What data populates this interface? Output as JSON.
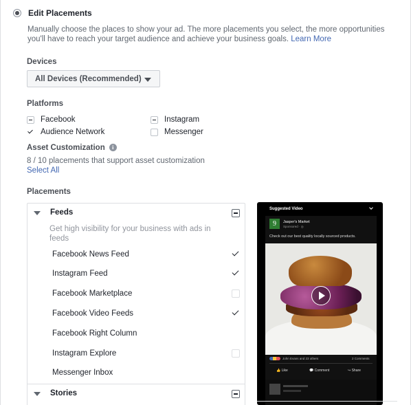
{
  "edit_placements": {
    "title": "Edit Placements",
    "description": "Manually choose the places to show your ad. The more placements you select, the more opportunities you'll have to reach your target audience and achieve your business goals.",
    "learn_more": "Learn More"
  },
  "devices": {
    "label": "Devices",
    "selected": "All Devices (Recommended)"
  },
  "platforms": {
    "label": "Platforms",
    "items": [
      {
        "label": "Facebook",
        "state": "indeterminate"
      },
      {
        "label": "Instagram",
        "state": "indeterminate"
      },
      {
        "label": "Audience Network",
        "state": "checked"
      },
      {
        "label": "Messenger",
        "state": "unchecked"
      }
    ]
  },
  "asset_customization": {
    "label": "Asset Customization",
    "count_text": "8 / 10 placements that support asset customization",
    "select_all": "Select All"
  },
  "placements": {
    "label": "Placements",
    "feeds": {
      "title": "Feeds",
      "description": "Get high visibility for your business with ads in feeds",
      "items": [
        {
          "label": "Facebook News Feed",
          "state": "checked"
        },
        {
          "label": "Instagram Feed",
          "state": "checked"
        },
        {
          "label": "Facebook Marketplace",
          "state": "unchecked"
        },
        {
          "label": "Facebook Video Feeds",
          "state": "checked"
        },
        {
          "label": "Facebook Right Column",
          "state": "none"
        },
        {
          "label": "Instagram Explore",
          "state": "unchecked"
        },
        {
          "label": "Messenger Inbox",
          "state": "none"
        }
      ]
    },
    "stories": {
      "title": "Stories"
    }
  },
  "preview": {
    "header": "Suggested Video",
    "page_name": "Jasper's Market",
    "sponsored": "Sponsored · ",
    "logo_letter": "9",
    "post_text": "Check out our best quality locally sourced products.",
    "reactions": "John Evans and 23 others",
    "comments": "2 Comments",
    "actions": [
      "Like",
      "Comment",
      "Share"
    ]
  },
  "colors": {
    "link": "#4267b2",
    "text": "#1d2129",
    "muted": "#606770",
    "logo_green": "#2f7d32"
  }
}
